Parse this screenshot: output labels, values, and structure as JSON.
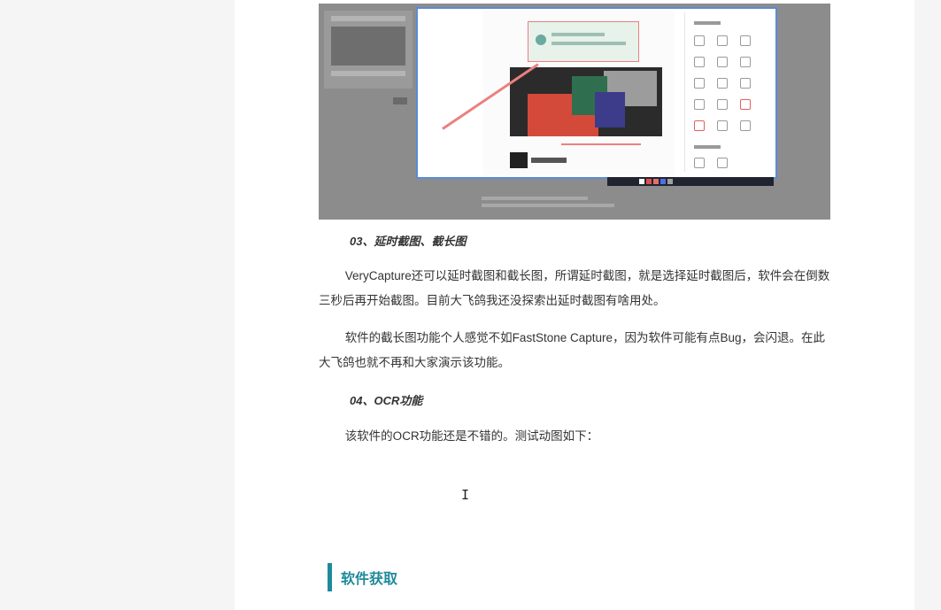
{
  "screenshot": {
    "alt_name": "verycapture-screenshot-image",
    "accent": "#5b8bd6",
    "arrow_color": "#ec8080"
  },
  "article": {
    "heading_3": "03、延时截图、截长图",
    "para_1": "VeryCapture还可以延时截图和截长图，所谓延时截图，就是选择延时截图后，软件会在倒数三秒后再开始截图。目前大飞鸽我还没探索出延时截图有啥用处。",
    "para_2": "软件的截长图功能个人感觉不如FastStone Capture，因为软件可能有点Bug，会闪退。在此大飞鸽也就不再和大家演示该功能。",
    "heading_4": "04、OCR功能",
    "para_3": "该软件的OCR功能还是不错的。测试动图如下：",
    "cursor_glyph": "I",
    "section_title": "软件获取",
    "section_accent": "#1e8a9a"
  }
}
